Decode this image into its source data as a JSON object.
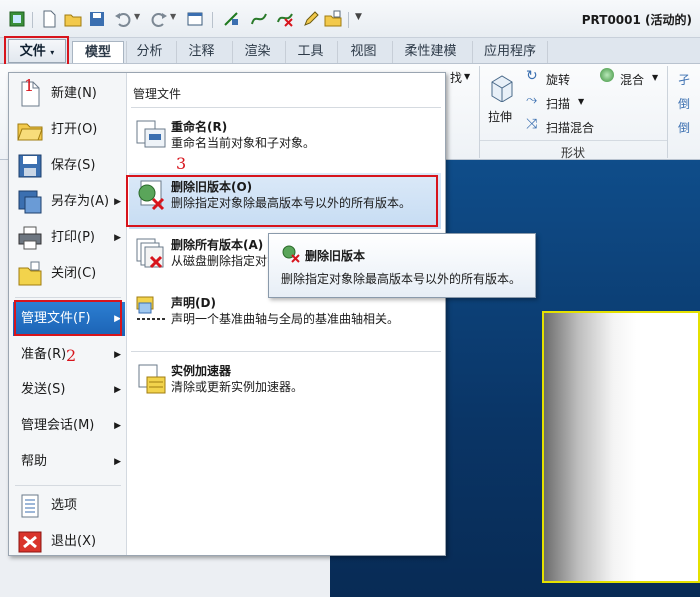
{
  "window": {
    "document_title": "PRT0001 (活动的)"
  },
  "tabs": [
    {
      "label": "文件"
    },
    {
      "label": "模型"
    },
    {
      "label": "分析"
    },
    {
      "label": "注释"
    },
    {
      "label": "渲染"
    },
    {
      "label": "工具"
    },
    {
      "label": "视图"
    },
    {
      "label": "柔性建模"
    },
    {
      "label": "应用程序"
    }
  ],
  "file_tab_arrow": "▾",
  "ribbon": {
    "extrude": "拉伸",
    "revolve": "旋转",
    "sweep": "扫描",
    "swept_blend": "扫描混合",
    "blend": "混合",
    "group_shapes": "形状",
    "partial_left": "找",
    "partial_right_1": "孑",
    "partial_right_2": "倒",
    "partial_right_3": "倒"
  },
  "file_menu": {
    "items": [
      {
        "label": "新建(N)"
      },
      {
        "label": "打开(O)"
      },
      {
        "label": "保存(S)"
      },
      {
        "label": "另存为(A)"
      },
      {
        "label": "打印(P)"
      },
      {
        "label": "关闭(C)"
      },
      {
        "label": "管理文件(F)"
      },
      {
        "label": "准备(R)"
      },
      {
        "label": "发送(S)"
      },
      {
        "label": "管理会话(M)"
      },
      {
        "label": "帮助"
      },
      {
        "label": "选项"
      },
      {
        "label": "退出(X)"
      }
    ],
    "submenu_heading": "管理文件",
    "submenu": [
      {
        "title": "重命名(R)",
        "desc": "重命名当前对象和子对象。"
      },
      {
        "title": "删除旧版本(O)",
        "desc": "删除指定对象除最高版本号以外的所有版本。"
      },
      {
        "title": "删除所有版本(A)",
        "desc": "从磁盘删除指定对象"
      },
      {
        "title": "声明(D)",
        "desc": "声明一个基准曲轴与全局的基准曲轴相关。"
      },
      {
        "title": "实例加速器",
        "desc": "清除或更新实例加速器。"
      }
    ]
  },
  "tooltip": {
    "title": "删除旧版本",
    "desc": "删除指定对象除最高版本号以外的所有版本。"
  },
  "annotations": {
    "step1": "1",
    "step2": "2",
    "step3": "3"
  },
  "colors": {
    "highlight": "#1c63b5",
    "annotation_red": "#d7141c",
    "viewport": "#0a3566",
    "part_edge": "#e4e100"
  }
}
